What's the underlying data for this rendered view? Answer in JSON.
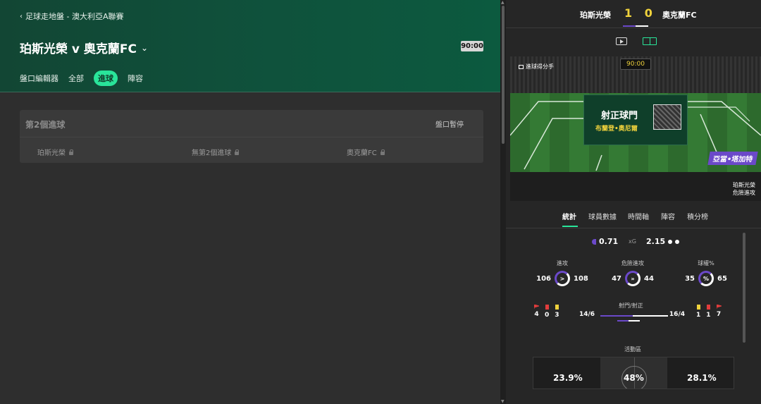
{
  "left": {
    "breadcrumb": "足球走地盤 - 澳大利亞A聯賽",
    "match_title": "珀斯光榮 v 奧克蘭FC",
    "clock": "90:00",
    "tabs": [
      "盤口編輯器",
      "全部",
      "進球",
      "陣容"
    ],
    "active_tab": "進球",
    "market": {
      "title": "第2個進球",
      "status": "盤口暫停",
      "outcomes": [
        "珀斯光榮",
        "無第2個進球",
        "奧克蘭FC"
      ]
    }
  },
  "right": {
    "scoreboard": {
      "home": "珀斯光榮",
      "score": "1 0",
      "away": "奧克蘭FC"
    },
    "pitch": {
      "label": "進球得分手",
      "clock": "90:00",
      "popup_title": "射正球門",
      "popup_player": "布蘭登•奧尼爾",
      "player_tag": "亞當•塔加特",
      "team_tag_line1": "珀斯光榮",
      "team_tag_line2": "危險進攻"
    },
    "subtabs": [
      "統計",
      "球員數據",
      "時間軸",
      "陣容",
      "積分榜"
    ],
    "active_subtab": "統計",
    "stats": {
      "xg_home": "0.71",
      "xg_label": "xG",
      "xg_away": "2.15",
      "attacks": {
        "label": "進攻",
        "home": "106",
        "away": "108",
        "icon": ">"
      },
      "dangerous": {
        "label": "危險進攻",
        "home": "47",
        "away": "44",
        "icon": "»"
      },
      "possession": {
        "label": "球權%",
        "home": "35",
        "away": "65",
        "icon": "%"
      },
      "corners_home": "4",
      "reds_home": "0",
      "yellows_home": "3",
      "shots_label": "射門/射正",
      "shots_home": "14/6",
      "shots_away": "16/4",
      "yellows_away": "1",
      "reds_away": "1",
      "corners_away": "7",
      "activity_label": "活動區",
      "activity_home": "23.9%",
      "activity_mid": "48%",
      "activity_away": "28.1%"
    }
  },
  "colors": {
    "accent": "#29e59a",
    "purple": "#6b49c9",
    "score": "#f0d23c"
  }
}
